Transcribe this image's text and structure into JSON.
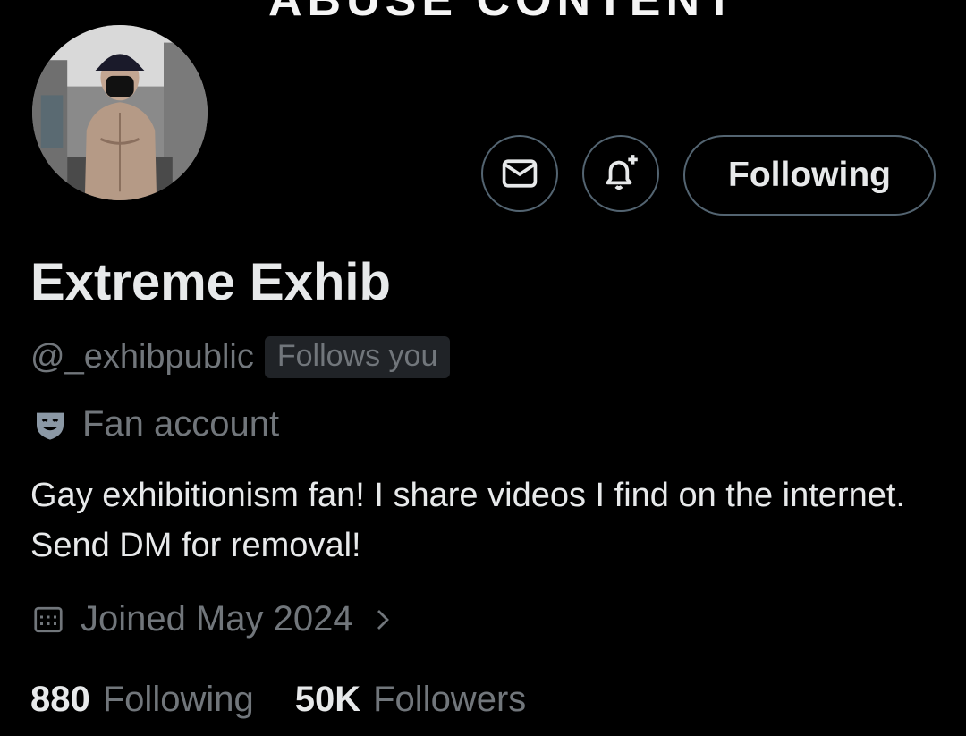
{
  "banner": {
    "text": "ABUSE CONTENT"
  },
  "actions": {
    "following_label": "Following"
  },
  "profile": {
    "display_name": "Extreme Exhib",
    "handle": "@_exhibpublic",
    "follows_you_badge": "Follows you",
    "account_label": "Fan account",
    "bio": "Gay exhibitionism fan! I share videos I find on the internet. Send DM for removal!",
    "joined": "Joined May 2024"
  },
  "stats": {
    "following_count": "880",
    "following_label": "Following",
    "followers_count": "50K",
    "followers_label": "Followers"
  },
  "icons": {
    "dm": "envelope-icon",
    "notify": "bell-plus-icon",
    "label": "theater-mask-badge-icon",
    "joined": "calendar-icon",
    "more": "chevron-right-icon"
  },
  "colors": {
    "background": "#000000",
    "primary_text": "#e7e9ea",
    "secondary_text": "#71767b",
    "border": "#536471",
    "badge_bg": "#202327"
  }
}
